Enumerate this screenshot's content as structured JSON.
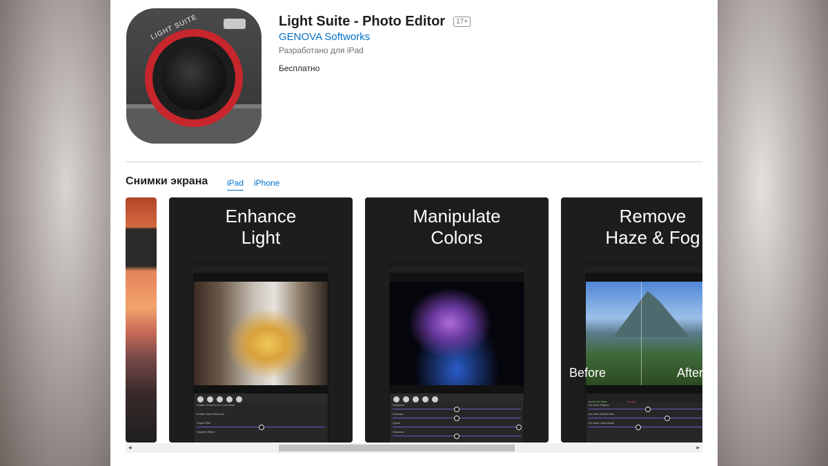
{
  "app": {
    "title": "Light Suite - Photo Editor",
    "age_rating": "17+",
    "developer": "GENOVA Softworks",
    "designed_for": "Разработано для iPad",
    "price": "Бесплатно",
    "icon_ring_text": "LIGHT SUITE"
  },
  "screenshots": {
    "heading": "Снимки экрана",
    "tabs": [
      {
        "label": "iPad",
        "selected": true
      },
      {
        "label": "iPhone",
        "selected": false
      }
    ],
    "items": [
      {
        "caption": "Enhance\nLight",
        "panel_rows": [
          "Enable Known Lens Correction",
          "Enable Haze Removal",
          "Sepia Filter",
          "Vignette Effect"
        ],
        "slider_positions": [
          0.05,
          0.08,
          0.5,
          0.5
        ]
      },
      {
        "caption": "Manipulate\nColors",
        "panel_rows": [
          "Exposure",
          "Contrast",
          "Lights",
          "Shadows"
        ],
        "slider_positions": [
          0.5,
          0.5,
          1.0,
          0.5
        ]
      },
      {
        "caption": "Remove\nHaze & Fog",
        "tabs": [
          "Apply De-Haze",
          "Cancel"
        ],
        "panel_rows": [
          "De-Haze Radius",
          "De-Haze Border Blur",
          "De-Haze Light Angle"
        ],
        "slider_positions": [
          0.5,
          0.65,
          0.4
        ],
        "before_label": "Before",
        "after_label": "After"
      }
    ]
  },
  "scrollbar": {
    "left_arrow": "◂",
    "right_arrow": "▸"
  }
}
